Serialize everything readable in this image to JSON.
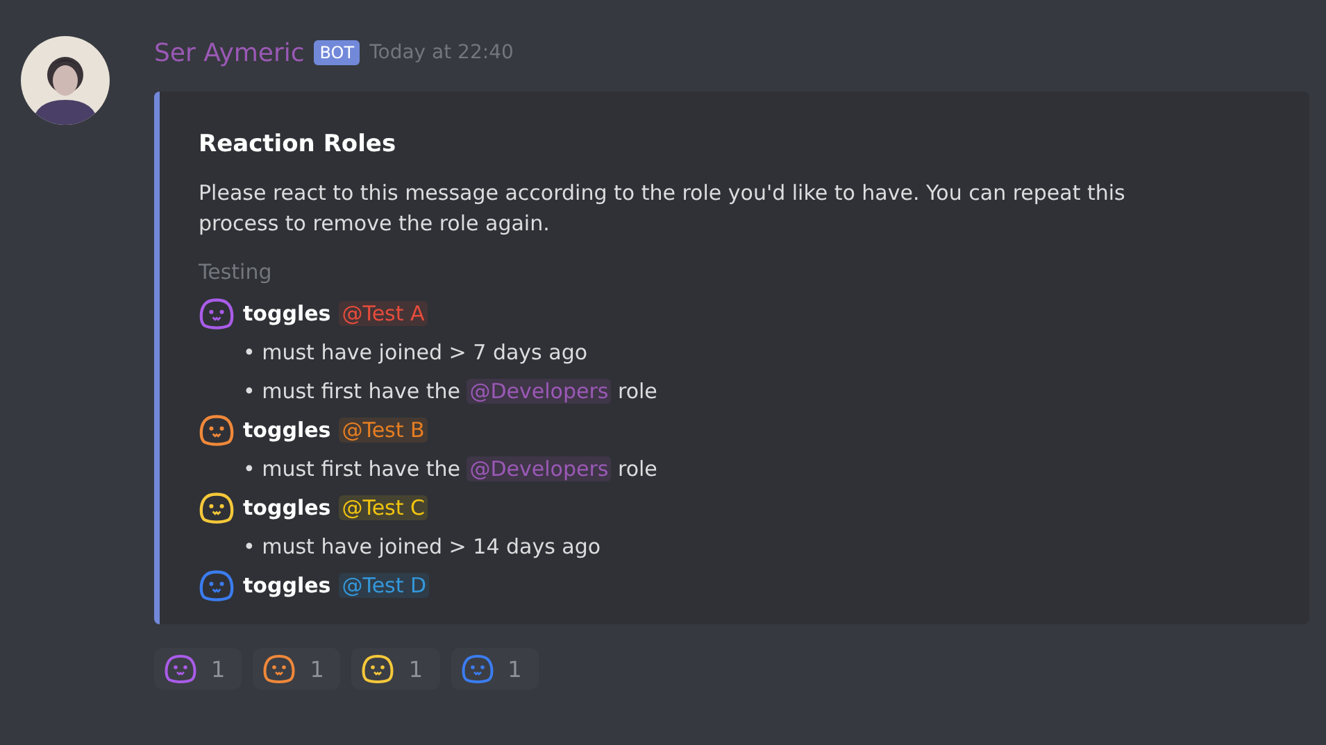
{
  "message": {
    "author": "Ser Aymeric",
    "badge": "BOT",
    "timestamp": "Today at 22:40"
  },
  "embed": {
    "title": "Reaction Roles",
    "description": "Please react to this message according to the role you'd like to have. You can repeat this process to remove the role again.",
    "section": "Testing",
    "roles": [
      {
        "emoji": {
          "color": "#a95ce8"
        },
        "action": "toggles",
        "mention": "@Test A",
        "color": "#e74c3c",
        "conditions": [
          {
            "kind": "text",
            "text": "• must have joined > 7 days ago"
          },
          {
            "kind": "mention",
            "before": "• must first have the",
            "mention": "@Developers",
            "color": "#9b59b6",
            "after": "role"
          }
        ]
      },
      {
        "emoji": {
          "color": "#f0883a"
        },
        "action": "toggles",
        "mention": "@Test B",
        "color": "#e67e22",
        "conditions": [
          {
            "kind": "mention",
            "before": "• must first have the",
            "mention": "@Developers",
            "color": "#9b59b6",
            "after": "role"
          }
        ]
      },
      {
        "emoji": {
          "color": "#f5c83a"
        },
        "action": "toggles",
        "mention": "@Test C",
        "color": "#f1c40f",
        "conditions": [
          {
            "kind": "text",
            "text": "• must have joined > 14 days ago"
          }
        ]
      },
      {
        "emoji": {
          "color": "#3b7cf0"
        },
        "action": "toggles",
        "mention": "@Test D",
        "color": "#3498db"
      }
    ]
  },
  "reactions": [
    {
      "color": "#a95ce8",
      "count": "1"
    },
    {
      "color": "#f0883a",
      "count": "1"
    },
    {
      "color": "#f5c83a",
      "count": "1"
    },
    {
      "color": "#3b7cf0",
      "count": "1"
    }
  ]
}
